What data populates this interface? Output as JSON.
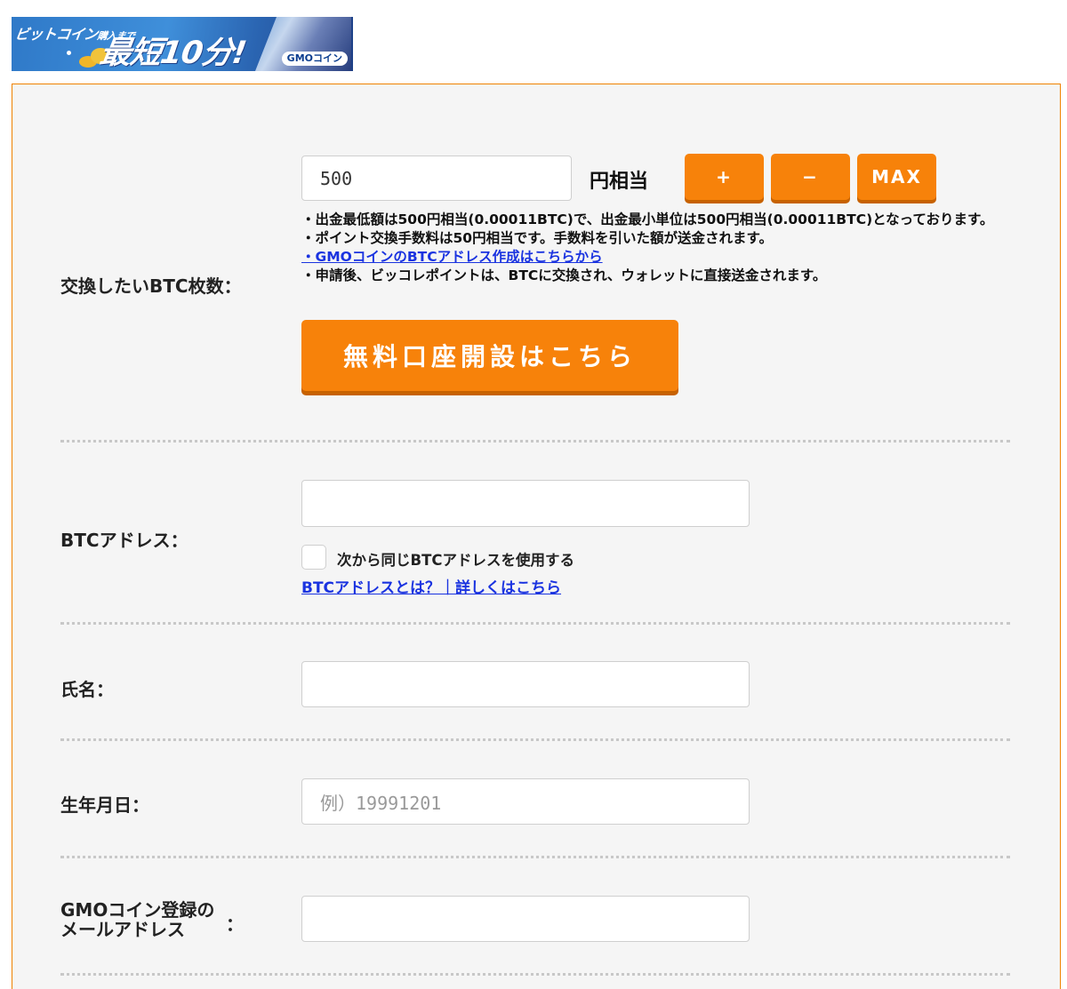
{
  "banner": {
    "line1": "ビットコイン",
    "line1_small": "購入まで",
    "headline": "最短10分!",
    "brand": "GMOコイン"
  },
  "form": {
    "btc_amount": {
      "label": "交換したいBTC枚数：",
      "value": "500",
      "unit": "円相当",
      "plus_label": "+",
      "minus_label": "−",
      "max_label": "MAX",
      "notes": [
        "・出金最低額は500円相当(0.00011BTC)で、出金最小単位は500円相当(0.00011BTC)となっております。",
        "・ポイント交換手数料は50円相当です。手数料を引いた額が送金されます。"
      ],
      "address_link": "・GMOコインのBTCアドレス作成はこちらから",
      "note_last": "・申請後、ビッコレポイントは、BTCに交換され、ウォレットに直接送金されます。",
      "cta_label": "無料口座開設はこちら"
    },
    "btc_address": {
      "label": "BTCアドレス：",
      "value": "",
      "checkbox_label": "次から同じBTCアドレスを使用する",
      "help_link": "BTCアドレスとは？｜詳しくはこちら"
    },
    "name": {
      "label": "氏名：",
      "value": ""
    },
    "birthdate": {
      "label": "生年月日：",
      "placeholder": "例）19991201"
    },
    "gmo_email": {
      "label_line1": "GMOコイン登録の",
      "label_line2": "メールアドレス",
      "colon": "：",
      "value": ""
    }
  },
  "colors": {
    "accent": "#f7820a",
    "panel_border": "#f08200",
    "link": "#1a33e0"
  }
}
